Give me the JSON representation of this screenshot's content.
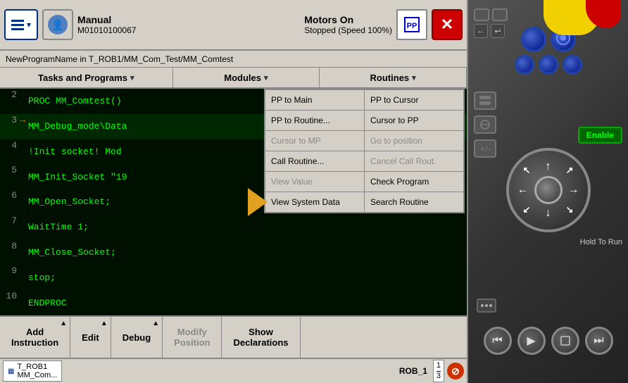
{
  "topbar": {
    "mode_label": "Manual",
    "system_id": "M01010100067",
    "motors_label": "Motors On",
    "motors_status": "Stopped (Speed 100%)",
    "pp_icon_symbol": "⊡",
    "close_symbol": "✕"
  },
  "path_bar": {
    "text": "NewProgramName in T_ROB1/MM_Com_Test/MM_Comtest"
  },
  "toolbar": {
    "tasks_label": "Tasks and Programs",
    "modules_label": "Modules",
    "routines_label": "Routines"
  },
  "code": {
    "lines": [
      {
        "num": "2",
        "arrow": "",
        "content": "PROC MM_Comtest()"
      },
      {
        "num": "3",
        "arrow": "→",
        "content": "    MM_Debug_mode\\Data"
      },
      {
        "num": "4",
        "arrow": "",
        "content": "    !Init socket! Mod"
      },
      {
        "num": "5",
        "arrow": "",
        "content": "    MM_Init_Socket \"19"
      },
      {
        "num": "6",
        "arrow": "",
        "content": "  MM_Open_Socket;"
      },
      {
        "num": "7",
        "arrow": "",
        "content": "  WaitTime 1;"
      },
      {
        "num": "8",
        "arrow": "",
        "content": "  MM_Close_Socket;"
      },
      {
        "num": "9",
        "arrow": "",
        "content": "    stop;"
      },
      {
        "num": "10",
        "arrow": "",
        "content": "ENDPROC"
      }
    ]
  },
  "dropdown": {
    "rows": [
      [
        {
          "label": "PP to Main",
          "disabled": false
        },
        {
          "label": "PP to Cursor",
          "disabled": false
        }
      ],
      [
        {
          "label": "PP to Routine...",
          "disabled": false
        },
        {
          "label": "Cursor to PP",
          "disabled": false
        }
      ],
      [
        {
          "label": "Cursor to MP",
          "disabled": true
        },
        {
          "label": "Go to position",
          "disabled": true
        }
      ],
      [
        {
          "label": "Call Routine...",
          "disabled": false
        },
        {
          "label": "Cancel Call Rout.",
          "disabled": true
        }
      ],
      [
        {
          "label": "View Value",
          "disabled": true
        },
        {
          "label": "Check Program",
          "disabled": false
        }
      ],
      [
        {
          "label": "View System Data",
          "disabled": false
        },
        {
          "label": "Search Routine",
          "disabled": false
        }
      ]
    ]
  },
  "bottom_bar": {
    "add_instruction": "Add\nInstruction",
    "edit_label": "Edit",
    "debug_label": "Debug",
    "modify_position": "Modify\nPosition",
    "show_declarations": "Show\nDeclarations"
  },
  "status_bar": {
    "task_text": "T_ROB1\nMM_Com...",
    "rob_label": "ROB_1",
    "fraction_top": "1",
    "fraction_bottom": "3"
  },
  "controller": {
    "enable_label": "Enable",
    "hold_to_run": "Hold To Run"
  }
}
